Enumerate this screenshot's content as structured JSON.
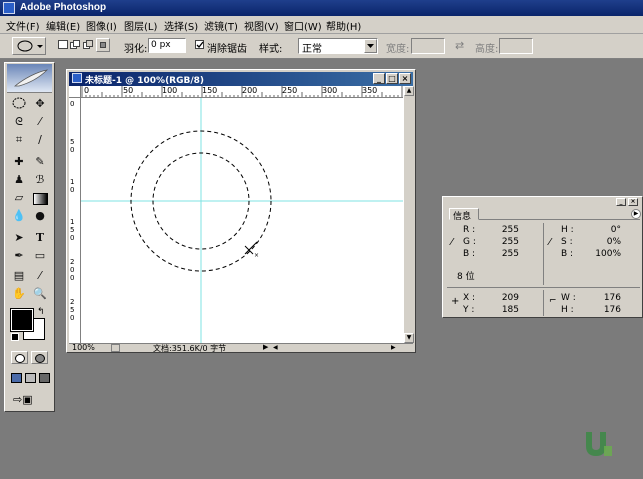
{
  "app": {
    "title": "Adobe Photoshop"
  },
  "menu": {
    "items": [
      "文件(F)",
      "编辑(E)",
      "图像(I)",
      "图层(L)",
      "选择(S)",
      "滤镜(T)",
      "视图(V)",
      "窗口(W)",
      "帮助(H)"
    ]
  },
  "options": {
    "feather_label": "羽化:",
    "feather_value": "0 px",
    "antialias_label": "消除锯齿",
    "antialias_checked": true,
    "style_label": "样式:",
    "style_value": "正常",
    "width_label": "宽度:",
    "height_label": "高度:"
  },
  "document": {
    "title": "未标题-1 @ 100%(RGB/8)",
    "zoom": "100%",
    "status": "文档:351.6K/0 字节",
    "ruler_h": [
      "0",
      "50",
      "100",
      "150",
      "200",
      "250",
      "300",
      "350"
    ],
    "ruler_v": [
      "0",
      "5",
      "0",
      "1",
      "0",
      "1",
      "5",
      "0",
      "2",
      "0",
      "0",
      "2",
      "5",
      "0"
    ],
    "guide_color": "#7fe3e3"
  },
  "info": {
    "tab": "信息",
    "rgb": [
      {
        "label": "R :",
        "value": "255"
      },
      {
        "label": "G :",
        "value": "255"
      },
      {
        "label": "B :",
        "value": "255"
      }
    ],
    "hsb": [
      {
        "label": "H :",
        "value": "0°"
      },
      {
        "label": "S :",
        "value": "0%"
      },
      {
        "label": "B :",
        "value": "100%"
      }
    ],
    "bits": "8 位",
    "xy": [
      {
        "label": "X :",
        "value": "209"
      },
      {
        "label": "Y :",
        "value": "185"
      }
    ],
    "wh": [
      {
        "label": "W :",
        "value": "176"
      },
      {
        "label": "H :",
        "value": "176"
      }
    ]
  },
  "colors": {
    "titlebar": "#0a246a",
    "chrome": "#d4d0c8",
    "workspace": "#7b7b7b"
  }
}
